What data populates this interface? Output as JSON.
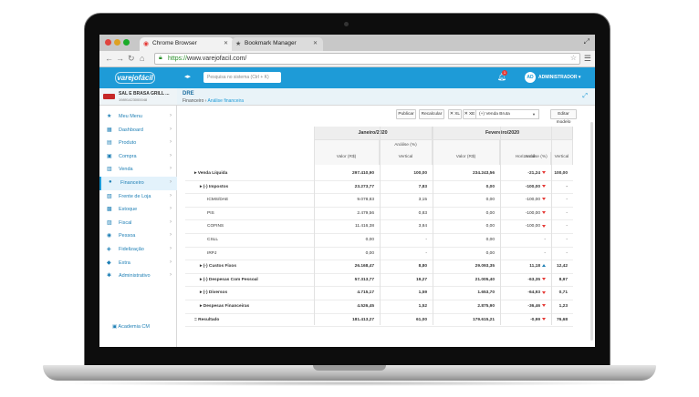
{
  "browser": {
    "tabs": [
      {
        "label": "Chrome Browser"
      },
      {
        "label": "Bookmark Manager"
      }
    ],
    "url_protocol": "https://",
    "url_host": "www.varejofacil.com/"
  },
  "colors": {
    "brand": "#1e9bd7",
    "down": "#e53935",
    "up": "#1e7fb5"
  },
  "app": {
    "logo": "varejofácil",
    "store_name": "SAL E BRASA GRILL ...",
    "store_cnpj": "19891423000048",
    "search_placeholder": "Pesquisa no sistema (Ctrl + K)",
    "notifications": "1",
    "avatar": "AD",
    "user": "ADMINISTRADOR",
    "page_title": "DRE",
    "crumb_parent": "Financeiro",
    "crumb_current": "Análise financeira",
    "academia": "Academia CM",
    "nav": [
      {
        "label": "Meu Menu",
        "icon": "star-icon",
        "glyph": "★"
      },
      {
        "label": "Dashboard",
        "icon": "dashboard-icon",
        "glyph": "▦"
      },
      {
        "label": "Produto",
        "icon": "product-icon",
        "glyph": "▤"
      },
      {
        "label": "Compra",
        "icon": "cart-in-icon",
        "glyph": "▣"
      },
      {
        "label": "Venda",
        "icon": "cart-icon",
        "glyph": "▥"
      },
      {
        "label": "Financeiro",
        "icon": "money-icon",
        "glyph": "●"
      },
      {
        "label": "Frente de Loja",
        "icon": "store-icon",
        "glyph": "▧"
      },
      {
        "label": "Estoque",
        "icon": "box-icon",
        "glyph": "▩"
      },
      {
        "label": "Fiscal",
        "icon": "fiscal-icon",
        "glyph": "▨"
      },
      {
        "label": "Pessoa",
        "icon": "person-icon",
        "glyph": "◉"
      },
      {
        "label": "Fidelização",
        "icon": "loyalty-icon",
        "glyph": "◈"
      },
      {
        "label": "Extra",
        "icon": "tag-icon",
        "glyph": "◆"
      },
      {
        "label": "Administrativo",
        "icon": "gear-icon",
        "glyph": "✱"
      }
    ],
    "toolbar": {
      "publicar": "Publicar",
      "recalcular": "Recalcular",
      "xls1": "✕ XL",
      "xls2": "✕ XE",
      "select": "(+) Venda Bruta",
      "editar": "Editar modelo"
    }
  },
  "table": {
    "periods": [
      "Janeiro/2020",
      "Fevereiro/2020"
    ],
    "subheaders": {
      "valor": "Valor (R$)",
      "analise": "Análise (%)",
      "vertical": "Vertical",
      "horizontal": "Horizontal"
    },
    "rows": [
      {
        "label": "Venda Líquida",
        "prefix": "▸",
        "indent": 0,
        "bold": true,
        "jan_v": "297.410,90",
        "jan_p": "100,00",
        "fev_v": "234.243,56",
        "fev_h": "-21,24",
        "fev_hd": "dn",
        "fev_p": "100,00"
      },
      {
        "label": "(-) Impostos",
        "prefix": "▸",
        "indent": 6,
        "bold": true,
        "jan_v": "23.273,77",
        "jan_p": "7,83",
        "fev_v": "0,00",
        "fev_h": "-100,00",
        "fev_hd": "dn",
        "fev_p": "-"
      },
      {
        "label": "ICMS/DAE",
        "prefix": "",
        "indent": 14,
        "bold": false,
        "jan_v": "9.078,83",
        "jan_p": "3,15",
        "fev_v": "0,00",
        "fev_h": "-100,00",
        "fev_hd": "dn",
        "fev_p": "-"
      },
      {
        "label": "PIS",
        "prefix": "",
        "indent": 14,
        "bold": false,
        "jan_v": "2.479,56",
        "jan_p": "0,83",
        "fev_v": "0,00",
        "fev_h": "-100,00",
        "fev_hd": "dn",
        "fev_p": "-"
      },
      {
        "label": "COFINS",
        "prefix": "",
        "indent": 14,
        "bold": false,
        "jan_v": "11.416,38",
        "jan_p": "3,84",
        "fev_v": "0,00",
        "fev_h": "-100,00",
        "fev_hd": "dn",
        "fev_p": "-"
      },
      {
        "label": "CSLL",
        "prefix": "",
        "indent": 14,
        "bold": false,
        "jan_v": "0,00",
        "jan_p": "-",
        "fev_v": "0,00",
        "fev_h": "-",
        "fev_hd": "",
        "fev_p": "-"
      },
      {
        "label": "IRPJ",
        "prefix": "",
        "indent": 14,
        "bold": false,
        "jan_v": "0,00",
        "jan_p": "-",
        "fev_v": "0,00",
        "fev_h": "-",
        "fev_hd": "",
        "fev_p": "-"
      },
      {
        "label": "(-) Custos Fixos",
        "prefix": "▸",
        "indent": 6,
        "bold": true,
        "jan_v": "26.168,47",
        "jan_p": "8,80",
        "fev_v": "29.093,35",
        "fev_h": "11,18",
        "fev_hd": "up",
        "fev_p": "12,42"
      },
      {
        "label": "(-) Despesas Com Pessoal",
        "prefix": "▸",
        "indent": 6,
        "bold": true,
        "jan_v": "57.313,77",
        "jan_p": "19,27",
        "fev_v": "21.005,40",
        "fev_h": "-63,35",
        "fev_hd": "dn",
        "fev_p": "8,97"
      },
      {
        "label": "(-) Diversos",
        "prefix": "▸",
        "indent": 6,
        "bold": true,
        "jan_v": "4.715,17",
        "jan_p": "1,59",
        "fev_v": "1.653,70",
        "fev_h": "-64,93",
        "fev_hd": "dn",
        "fev_p": "0,71"
      },
      {
        "label": "Despesas Financeiras",
        "prefix": "▸",
        "indent": 6,
        "bold": true,
        "jan_v": "4.526,45",
        "jan_p": "1,52",
        "fev_v": "2.875,90",
        "fev_h": "-36,46",
        "fev_hd": "dn",
        "fev_p": "1,23"
      },
      {
        "label": "Resultado",
        "prefix": "=",
        "indent": 0,
        "bold": true,
        "jan_v": "181.413,27",
        "jan_p": "61,00",
        "fev_v": "179.615,21",
        "fev_h": "-0,99",
        "fev_hd": "dn",
        "fev_p": "76,68"
      }
    ]
  }
}
